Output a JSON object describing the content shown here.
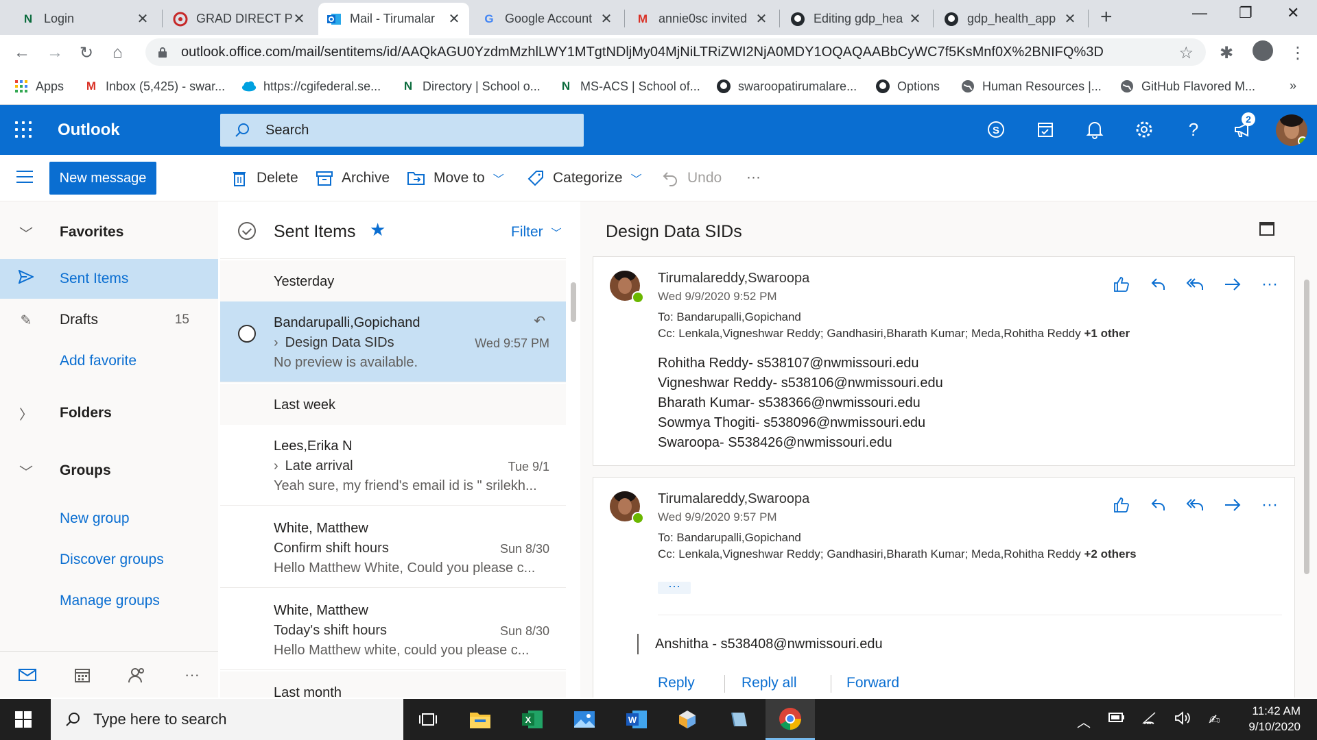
{
  "browser": {
    "tabs": [
      {
        "title": "Login",
        "favicon": "n-letter-icon",
        "color": "#0a6b3c"
      },
      {
        "title": "GRAD DIRECT P",
        "favicon": "wheel-logo-icon",
        "color": "#c62828"
      },
      {
        "title": "Mail - Tirumalar",
        "favicon": "outlook-icon",
        "color": "#0a6ed1",
        "active": true
      },
      {
        "title": "Google Account",
        "favicon": "google-g-icon",
        "color": "#4285f4"
      },
      {
        "title": "annie0sc invited",
        "favicon": "gmail-icon",
        "color": "#d93025"
      },
      {
        "title": "Editing gdp_hea",
        "favicon": "github-icon",
        "color": "#24292e"
      },
      {
        "title": "gdp_health_app",
        "favicon": "github-icon",
        "color": "#24292e"
      }
    ],
    "url": "outlook.office.com/mail/sentitems/id/AAQkAGU0YzdmMzhlLWY1MTgtNDljMy04MjNiLTRiZWI2NjA0MDY1OQAQAABbCyWC7f5KsMnf0X%2BNIFQ%3D",
    "bookmarks": [
      {
        "label": "Apps",
        "icon": "apps-grid-icon"
      },
      {
        "label": "Inbox (5,425) - swar...",
        "icon": "gmail-icon"
      },
      {
        "label": "https://cgifederal.se...",
        "icon": "cloud-icon"
      },
      {
        "label": "Directory | School o...",
        "icon": "n-letter-icon"
      },
      {
        "label": "MS-ACS | School of...",
        "icon": "n-letter-icon"
      },
      {
        "label": "swaroopatirumalare...",
        "icon": "github-icon"
      },
      {
        "label": "Options",
        "icon": "github-icon"
      },
      {
        "label": "Human Resources |...",
        "icon": "globe-icon"
      },
      {
        "label": "GitHub Flavored M...",
        "icon": "globe-icon"
      }
    ],
    "bookmarks_more": "»"
  },
  "outlook": {
    "brand": "Outlook",
    "search_placeholder": "Search",
    "notification_count": "2",
    "commands": {
      "new_message": "New message",
      "delete": "Delete",
      "archive": "Archive",
      "move_to": "Move to",
      "categorize": "Categorize",
      "undo": "Undo",
      "more": "···"
    },
    "nav": {
      "favorites": "Favorites",
      "sent_items": "Sent Items",
      "drafts": "Drafts",
      "drafts_count": "15",
      "add_favorite": "Add favorite",
      "folders": "Folders",
      "groups": "Groups",
      "new_group": "New group",
      "discover_groups": "Discover groups",
      "manage_groups": "Manage groups"
    },
    "list": {
      "title": "Sent Items",
      "filter": "Filter",
      "groups": [
        "Yesterday",
        "Last week",
        "Last month"
      ],
      "messages": [
        {
          "from": "Bandarupalli,Gopichand",
          "subject": "Design Data SIDs",
          "date": "Wed 9:57 PM",
          "preview": "No preview is available."
        },
        {
          "from": "Lees,Erika N",
          "subject": "Late arrival",
          "date": "Tue 9/1",
          "preview": "Yeah sure, my friend's email id is \" srilekh..."
        },
        {
          "from": "White, Matthew",
          "subject": "Confirm shift hours",
          "date": "Sun 8/30",
          "preview": "Hello Matthew White, Could you please c..."
        },
        {
          "from": "White, Matthew",
          "subject": "Today's shift hours",
          "date": "Sun 8/30",
          "preview": "Hello Matthew white, could you please c..."
        }
      ]
    },
    "reading": {
      "subject": "Design Data SIDs",
      "messages": [
        {
          "sender": "Tirumalareddy,Swaroopa",
          "when": "Wed 9/9/2020 9:52 PM",
          "to_label": "To:",
          "to": "Bandarupalli,Gopichand",
          "cc_label": "Cc:",
          "cc": "Lenkala,Vigneshwar Reddy; Gandhasiri,Bharath Kumar; Meda,Rohitha Reddy",
          "cc_more": "+1 other",
          "body": [
            "Rohitha Reddy-   s538107@nwmissouri.edu",
            "Vigneshwar Reddy- s538106@nwmissouri.edu",
            "Bharath Kumar- s538366@nwmissouri.edu",
            "Sowmya Thogiti- s538096@nwmissouri.edu",
            "Swaroopa- S538426@nwmissouri.edu"
          ]
        },
        {
          "sender": "Tirumalareddy,Swaroopa",
          "when": "Wed 9/9/2020 9:57 PM",
          "to_label": "To:",
          "to": "Bandarupalli,Gopichand",
          "cc_label": "Cc:",
          "cc": "Lenkala,Vigneshwar Reddy; Gandhasiri,Bharath Kumar; Meda,Rohitha Reddy",
          "cc_more": "+2 others",
          "expand": "···",
          "body": [
            "Anshitha - s538408@nwmissouri.edu"
          ]
        }
      ],
      "reply": "Reply",
      "reply_all": "Reply all",
      "forward": "Forward"
    }
  },
  "taskbar": {
    "search_placeholder": "Type here to search",
    "time": "11:42 AM",
    "date": "9/10/2020"
  }
}
